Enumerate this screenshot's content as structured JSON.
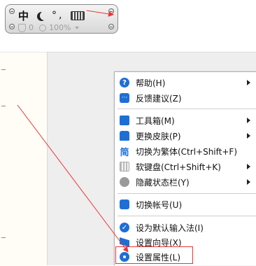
{
  "ime_toolbar": {
    "lang": "中",
    "punct": "°,",
    "shield_count": "0",
    "zoom": "100%"
  },
  "menu": {
    "items": [
      {
        "label": "帮助(H)",
        "icon": "help-icon",
        "submenu": true
      },
      {
        "label": "反馈建议(Z)",
        "icon": "feedback-icon",
        "submenu": false
      },
      {
        "label": "工具箱(M)",
        "icon": "toolbox-icon",
        "submenu": true
      },
      {
        "label": "更换皮肤(P)",
        "icon": "skin-icon",
        "submenu": true
      },
      {
        "label": "切换为繁体(Ctrl+Shift+F)",
        "icon": "traditional-chinese-icon",
        "submenu": false
      },
      {
        "label": "软键盘(Ctrl+Shift+K)",
        "icon": "soft-keyboard-icon",
        "submenu": true
      },
      {
        "label": "隐藏状态栏(Y)",
        "icon": "hide-statusbar-icon",
        "submenu": true
      },
      {
        "label": "切换帐号(U)",
        "icon": "user-icon",
        "submenu": false
      },
      {
        "label": "设为默认输入法(I)",
        "icon": "default-check-icon",
        "submenu": false
      },
      {
        "label": "设置向导(X)",
        "icon": "wizard-flag-icon",
        "submenu": false
      },
      {
        "label": "设置属性(L)",
        "icon": "gear-icon",
        "submenu": false
      }
    ]
  },
  "colors": {
    "accent": "#1d6fd6",
    "annotation": "#e33333"
  }
}
